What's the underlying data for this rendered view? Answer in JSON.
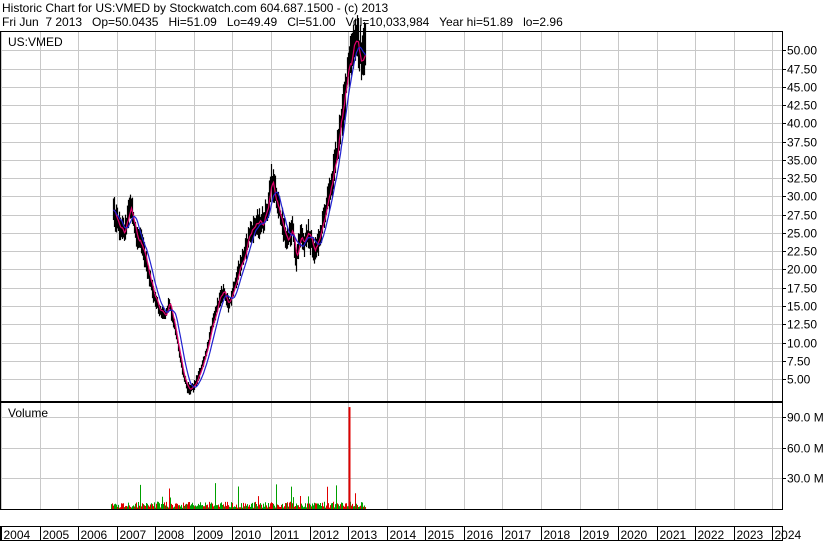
{
  "header": {
    "line1": "Historic Chart for US:VMED by Stockwatch.com 604.687.1500 - (c) 2013",
    "line2": "Fri Jun  7 2013   Op=50.0435   Hi=51.09   Lo=49.49   Cl=51.00   Vol=10,033,984   Year hi=51.89   lo=2.96"
  },
  "colors": {
    "grid": "#c8c8c8",
    "price_bar": "#000000",
    "ma_short": "#e0006c",
    "ma_long": "#2020d0",
    "vol_up": "#00a000",
    "vol_down": "#e00000"
  },
  "chart_data": [
    {
      "type": "line",
      "label": "US:VMED",
      "ylim": [
        2.0,
        52.5
      ],
      "yticks": [
        "5.00",
        "7.50",
        "10.00",
        "12.50",
        "15.00",
        "17.50",
        "20.00",
        "22.50",
        "25.00",
        "27.50",
        "30.00",
        "32.50",
        "35.00",
        "37.50",
        "40.00",
        "42.50",
        "45.00",
        "47.50",
        "50.00"
      ],
      "x": [
        2006.9,
        2007.05,
        2007.2,
        2007.35,
        2007.5,
        2007.65,
        2007.8,
        2007.95,
        2008.1,
        2008.25,
        2008.35,
        2008.5,
        2008.6,
        2008.7,
        2008.8,
        2008.9,
        2009.0,
        2009.15,
        2009.3,
        2009.45,
        2009.6,
        2009.75,
        2009.9,
        2010.0,
        2010.15,
        2010.3,
        2010.45,
        2010.6,
        2010.75,
        2010.9,
        2011.0,
        2011.1,
        2011.25,
        2011.4,
        2011.55,
        2011.65,
        2011.75,
        2011.85,
        2011.95,
        2012.1,
        2012.25,
        2012.4,
        2012.5,
        2012.6,
        2012.7,
        2012.8,
        2012.9,
        2013.0,
        2013.1,
        2013.2,
        2013.3,
        2013.38,
        2013.44
      ],
      "series": [
        {
          "values": [
            28.0,
            26.0,
            25.0,
            29.0,
            24.5,
            23.5,
            20.0,
            16.5,
            14.5,
            13.5,
            15.5,
            12.0,
            9.0,
            6.0,
            4.0,
            3.5,
            4.0,
            6.0,
            8.5,
            12.0,
            15.0,
            17.0,
            15.0,
            17.0,
            20.0,
            22.0,
            25.0,
            26.0,
            26.5,
            28.0,
            32.5,
            30.5,
            27.0,
            24.0,
            25.5,
            21.0,
            25.0,
            23.5,
            25.0,
            22.5,
            24.0,
            28.0,
            30.0,
            33.0,
            36.0,
            40.0,
            43.0,
            48.0,
            50.5,
            51.5,
            49.5,
            50.0,
            51.0
          ]
        }
      ]
    },
    {
      "type": "bar",
      "label": "Volume",
      "ylim": [
        0,
        104
      ],
      "yticks": [
        "30.0 M",
        "60.0 M",
        "90.0 M"
      ],
      "x_start": 2006.85,
      "x_end": 2013.45,
      "spike_x": 2013.02,
      "spike_value": 100,
      "typical_max": 12
    }
  ],
  "xaxis": {
    "years": [
      "2004",
      "2005",
      "2006",
      "2007",
      "2008",
      "2009",
      "2010",
      "2011",
      "2012",
      "2013",
      "2014",
      "2015",
      "2016",
      "2017",
      "2018",
      "2019",
      "2020",
      "2021",
      "2022",
      "2023",
      "2024"
    ]
  }
}
